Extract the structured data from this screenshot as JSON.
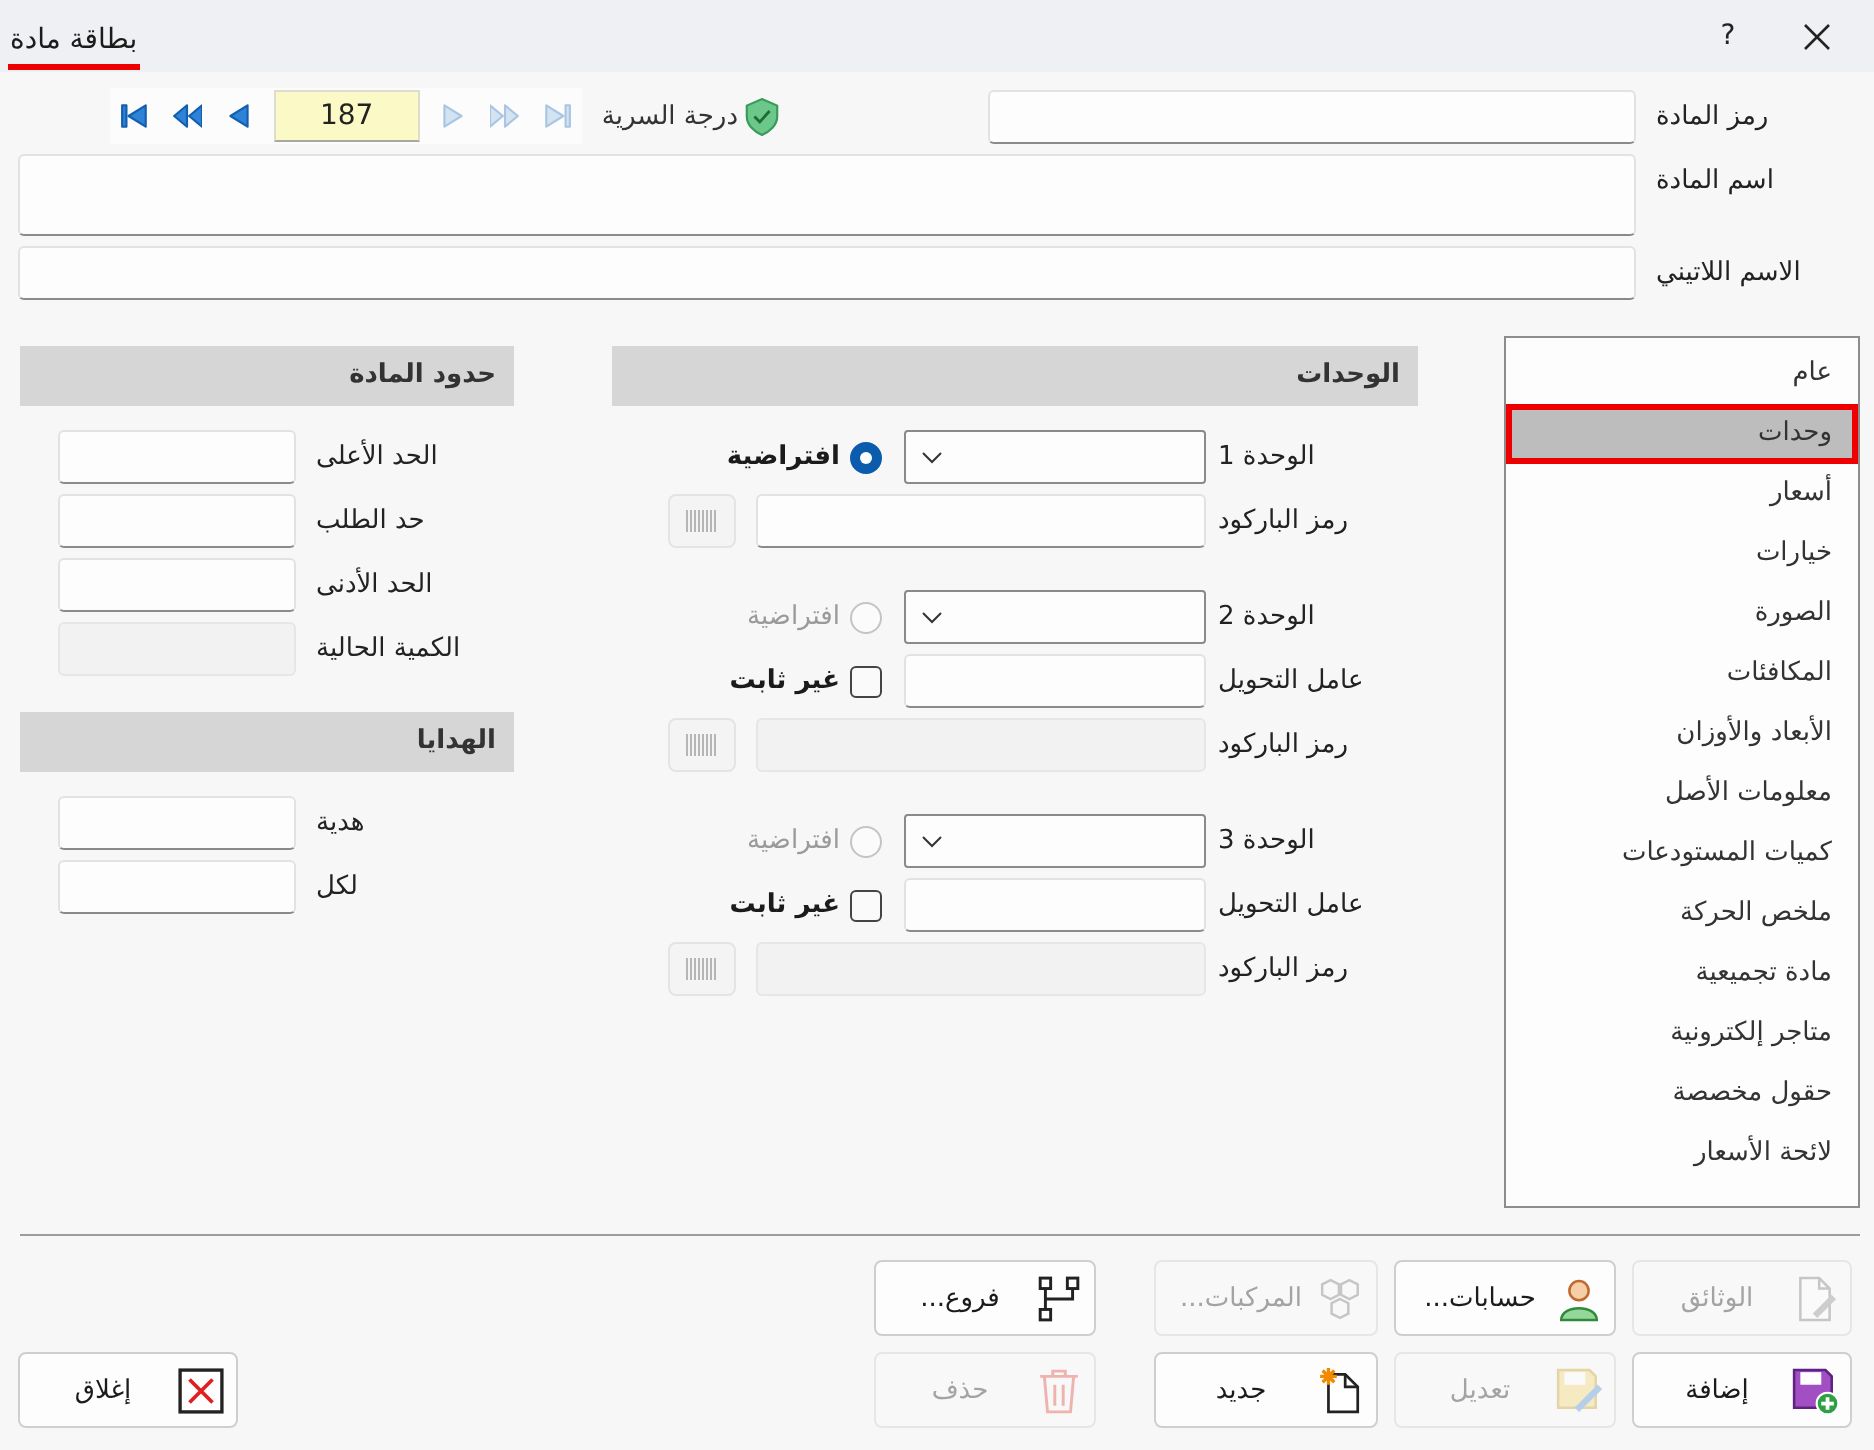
{
  "window": {
    "title": "بطاقة مادة",
    "help": "?"
  },
  "navigator": {
    "record": "187",
    "buttons": [
      {
        "kind": "first",
        "disabled": false
      },
      {
        "kind": "fast_back",
        "disabled": false
      },
      {
        "kind": "back",
        "disabled": false
      },
      {
        "kind": "forward",
        "disabled": true
      },
      {
        "kind": "fast_forward",
        "disabled": true
      },
      {
        "kind": "last",
        "disabled": true
      }
    ]
  },
  "security": {
    "label": "درجة السرية"
  },
  "header_fields": [
    {
      "label": "رمز المادة",
      "kind": "single"
    },
    {
      "label": "اسم المادة",
      "kind": "multi"
    },
    {
      "label": "الاسم اللاتيني",
      "kind": "single"
    }
  ],
  "tabs": [
    {
      "label": "عام",
      "selected": false
    },
    {
      "label": "وحدات",
      "selected": true
    },
    {
      "label": "أسعار",
      "selected": false
    },
    {
      "label": "خيارات",
      "selected": false
    },
    {
      "label": "الصورة",
      "selected": false
    },
    {
      "label": "المكافئات",
      "selected": false
    },
    {
      "label": "الأبعاد والأوزان",
      "selected": false
    },
    {
      "label": "معلومات الأصل",
      "selected": false
    },
    {
      "label": "كميات المستودعات",
      "selected": false
    },
    {
      "label": "ملخص الحركة",
      "selected": false
    },
    {
      "label": "مادة تجميعية",
      "selected": false
    },
    {
      "label": "متاجر إلكترونية",
      "selected": false
    },
    {
      "label": "حقول مخصصة",
      "selected": false
    },
    {
      "label": "لائحة الأسعار",
      "selected": false
    }
  ],
  "units": {
    "title": "الوحدات",
    "groups": [
      {
        "unit_label": "الوحدة 1",
        "default": {
          "label": "افتراضية",
          "selected": true,
          "disabled": false
        },
        "barcode": {
          "label": "رمز الباركود",
          "disabled": false
        }
      },
      {
        "unit_label": "الوحدة 2",
        "default": {
          "label": "افتراضية",
          "selected": false,
          "disabled": true
        },
        "conversion": {
          "label": "عامل التحويل",
          "variable_label": "غير ثابت",
          "checked": false
        },
        "barcode": {
          "label": "رمز الباركود",
          "disabled": true
        }
      },
      {
        "unit_label": "الوحدة 3",
        "default": {
          "label": "افتراضية",
          "selected": false,
          "disabled": true
        },
        "conversion": {
          "label": "عامل التحويل",
          "variable_label": "غير ثابت",
          "checked": false
        },
        "barcode": {
          "label": "رمز الباركود",
          "disabled": true
        }
      }
    ]
  },
  "limits": {
    "title": "حدود المادة",
    "fields": [
      {
        "label": "الحد الأعلى",
        "disabled": false
      },
      {
        "label": "حد الطلب",
        "disabled": false
      },
      {
        "label": "الحد الأدنى",
        "disabled": false
      },
      {
        "label": "الكمية الحالية",
        "disabled": true
      }
    ]
  },
  "gifts": {
    "title": "الهدايا",
    "fields": [
      {
        "label": "هدية",
        "disabled": false
      },
      {
        "label": "لكل",
        "disabled": false
      }
    ]
  },
  "actions": {
    "rows": [
      [
        {
          "label": "الوثائق",
          "kind": "documents",
          "disabled": true
        },
        {
          "label": "حسابات...",
          "kind": "accounts",
          "disabled": false
        },
        {
          "label": "المركبات...",
          "kind": "components",
          "disabled": true
        },
        {
          "label": "فروع...",
          "kind": "branches",
          "disabled": false
        }
      ],
      [
        {
          "label": "إضافة",
          "kind": "add",
          "disabled": false
        },
        {
          "label": "تعديل",
          "kind": "edit",
          "disabled": true
        },
        {
          "label": "جديد",
          "kind": "new",
          "disabled": false
        },
        {
          "label": "حذف",
          "kind": "delete",
          "disabled": true
        },
        {
          "label": "إغلاق",
          "kind": "close",
          "disabled": false
        }
      ]
    ]
  }
}
